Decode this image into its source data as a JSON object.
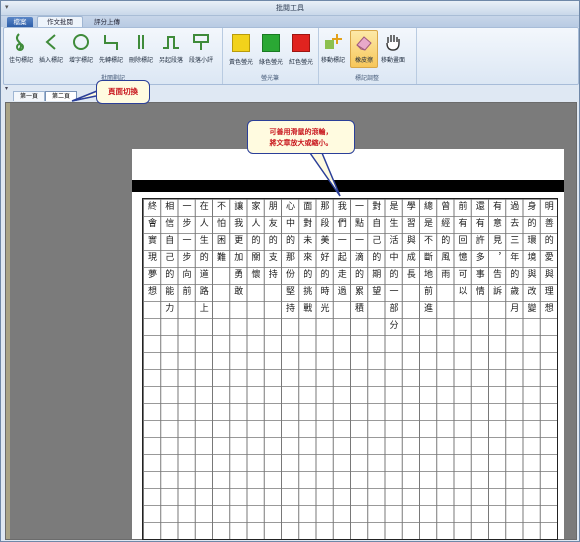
{
  "window": {
    "title": "批閱工具"
  },
  "menu_tabs": [
    {
      "label": "檔案"
    },
    {
      "label": "作文批閱"
    },
    {
      "label": "評分上傳"
    }
  ],
  "ribbon": {
    "groups": [
      {
        "label": "批閱劃記",
        "buttons": [
          {
            "label": "佳句標記",
            "icon": "hook-icon"
          },
          {
            "label": "插入標記",
            "icon": "chevron-left-icon"
          },
          {
            "label": "增字標記",
            "icon": "circle-icon"
          },
          {
            "label": "先轉標記",
            "icon": "swap-mark-icon"
          },
          {
            "label": "刪除標記",
            "icon": "double-line-icon"
          },
          {
            "label": "另起段落",
            "icon": "paragraph-icon"
          },
          {
            "label": "段落小評",
            "icon": "comment-sign-icon"
          }
        ]
      },
      {
        "label": "螢光筆",
        "buttons": [
          {
            "label": "黃色螢光",
            "icon": "yellow-square-icon",
            "color": "#f2d21b"
          },
          {
            "label": "綠色螢光",
            "icon": "green-square-icon",
            "color": "#2aa834"
          },
          {
            "label": "紅色螢光",
            "icon": "red-square-icon",
            "color": "#e0231f"
          }
        ]
      },
      {
        "label": "標記調整",
        "buttons": [
          {
            "label": "移動標記",
            "icon": "move-mark-icon"
          },
          {
            "label": "橡皮擦",
            "icon": "eraser-icon",
            "selected": true
          },
          {
            "label": "移動畫面",
            "icon": "hand-icon"
          }
        ]
      }
    ]
  },
  "doc_tabs": [
    {
      "label": "第一頁"
    },
    {
      "label": "第二頁"
    }
  ],
  "callouts": {
    "page_switch": "頁面切換",
    "zoom_hint_line1": "可善用滑鼠的滾輪，",
    "zoom_hint_line2": "將文章放大或縮小。"
  },
  "handwriting_columns": [
    "明善的愛與理想",
    "身的環境與改變",
    "過去三年的歲月",
    "有意見，告訴",
    "還有許多事情",
    "前有回憶可以",
    "曾經的風雨",
    "總是不斷地前進",
    "學習與成長",
    "是生活中的一部分",
    "對自己的期望",
    "一點一滴的累積",
    "我們一起走過",
    "那段美好的時光",
    "面對未來的挑戰",
    "心中的那份堅持",
    "朋友的支持",
    "家人的關懷",
    "讓我更加勇敢",
    "不怕困難",
    "在人生的道路上",
    "一步一步向前",
    "相信自己的能力",
    "終會實現夢想"
  ]
}
